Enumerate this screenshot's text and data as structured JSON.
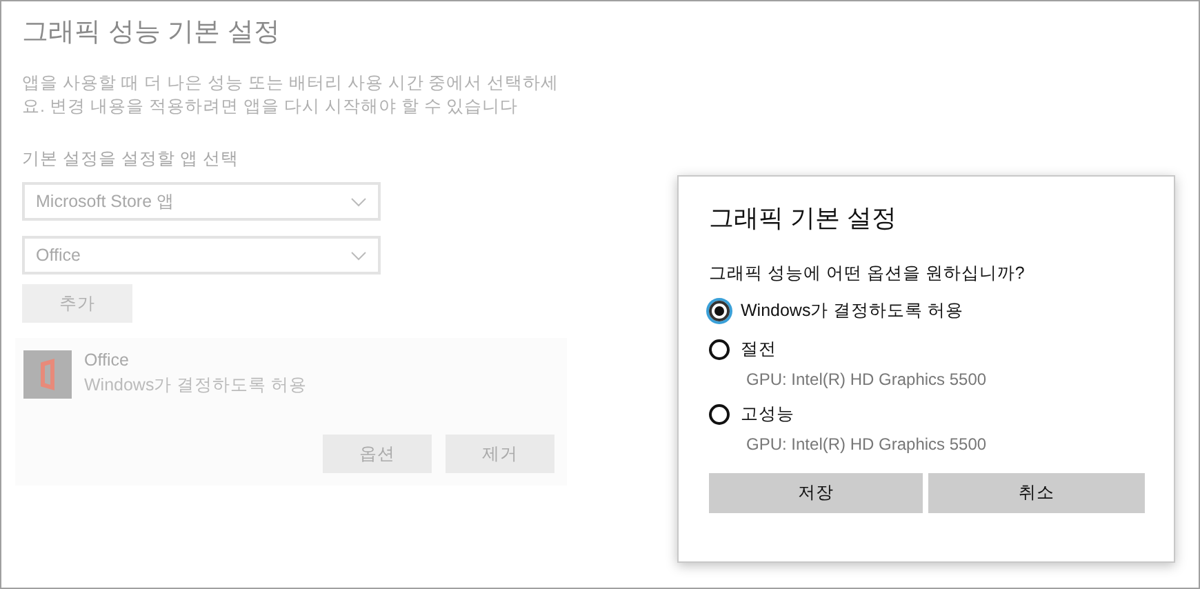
{
  "page": {
    "title": "그래픽 성능 기본 설정",
    "description": "앱을 사용할 때 더 나은 성능 또는 배터리 사용 시간 중에서 선택하세요. 변경 내용을 적용하려면 앱을 다시 시작해야 할 수 있습니다",
    "select_label": "기본 설정을 설정할 앱 선택",
    "dropdowns": [
      {
        "value": "Microsoft Store 앱"
      },
      {
        "value": "Office"
      }
    ],
    "add_button": "추가",
    "app": {
      "name": "Office",
      "setting": "Windows가 결정하도록 허용",
      "buttons": [
        "옵션",
        "제거"
      ]
    }
  },
  "dialog": {
    "title": "그래픽 기본 설정",
    "question": "그래픽 성능에 어떤 옵션을 원하십니까?",
    "options": [
      {
        "label": "Windows가 결정하도록 허용",
        "selected": true
      },
      {
        "label": "절전",
        "detail": "GPU: Intel(R) HD Graphics 5500",
        "selected": false
      },
      {
        "label": "고성능",
        "detail": "GPU: Intel(R) HD Graphics 5500",
        "selected": false
      }
    ],
    "buttons": [
      "저장",
      "취소"
    ]
  }
}
